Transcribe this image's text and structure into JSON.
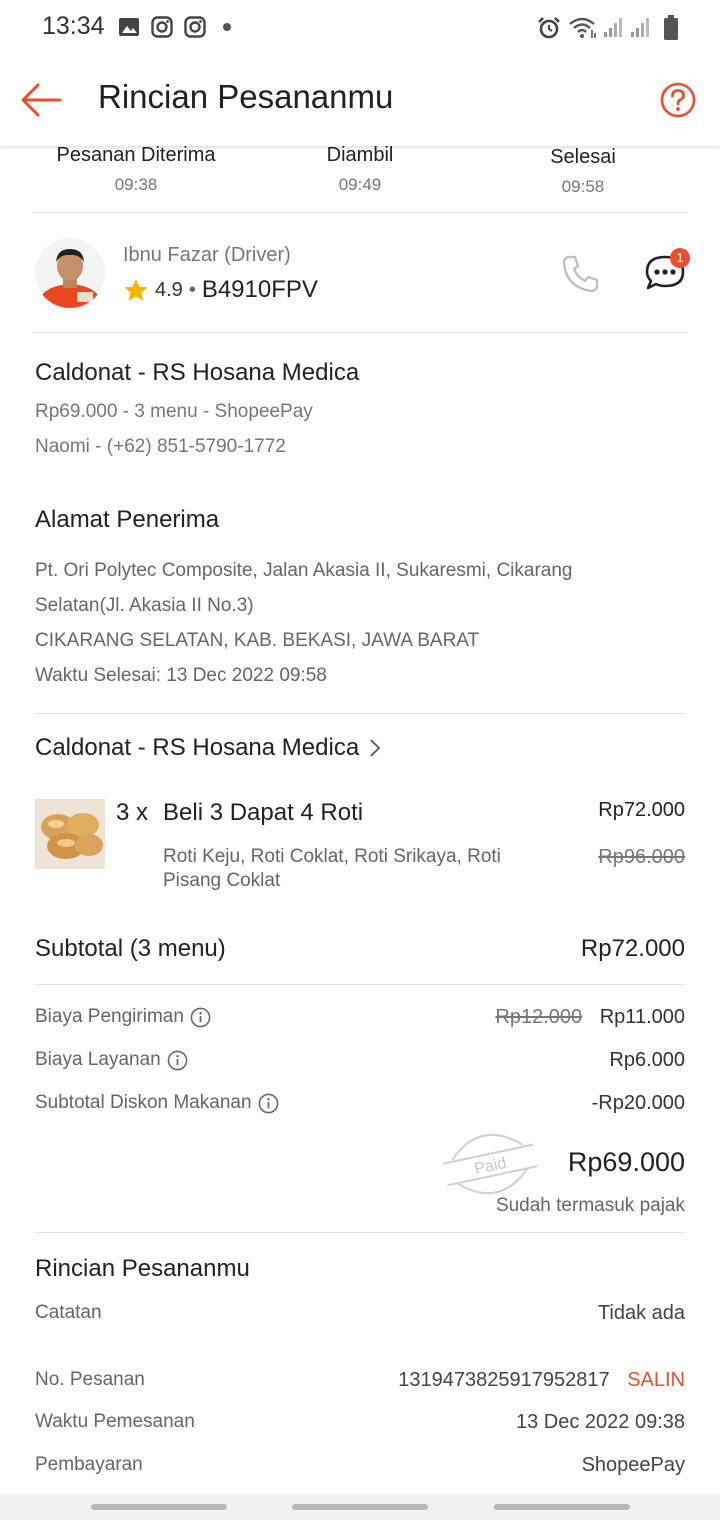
{
  "status_bar": {
    "time": "13:34"
  },
  "header": {
    "title": "Rincian Pesananmu"
  },
  "steps": [
    {
      "label": "Pesanan Diterima",
      "time": "09:38"
    },
    {
      "label": "Diambil",
      "time": "09:49"
    },
    {
      "label": "Selesai",
      "time": "09:58"
    }
  ],
  "driver": {
    "name": "Ibnu Fazar (Driver)",
    "rating": "4.9",
    "separator": "•",
    "plate": "B4910FPV",
    "chat_badge": "1"
  },
  "order_summary": {
    "store": "Caldonat - RS Hosana Medica",
    "line1": "Rp69.000 - 3 menu  - ShopeePay",
    "line2": "Naomi - (+62) 851-5790-1772"
  },
  "address": {
    "heading": "Alamat Penerima",
    "line1": "Pt. Ori Polytec Composite, Jalan Akasia II, Sukaresmi, Cikarang",
    "line2": "Selatan(Jl. Akasia II No.3)",
    "line3": "CIKARANG SELATAN, KAB. BEKASI, JAWA BARAT",
    "completed": "Waktu Selesai: 13 Dec 2022 09:58"
  },
  "store_section": {
    "name": "Caldonat - RS Hosana Medica"
  },
  "item": {
    "qty": "3 x",
    "name": "Beli 3 Dapat 4 Roti",
    "price": "Rp72.000",
    "options_line1": "Roti Keju, Roti Coklat, Roti Srikaya, Roti",
    "options_line2": "Pisang Coklat",
    "original_price": "Rp96.000"
  },
  "subtotal": {
    "label": "Subtotal (3 menu)",
    "value": "Rp72.000"
  },
  "fees": [
    {
      "label": "Biaya Pengiriman",
      "original": "Rp12.000",
      "value": "Rp11.000"
    },
    {
      "label": "Biaya Layanan",
      "value": "Rp6.000"
    },
    {
      "label": "Subtotal Diskon Makanan",
      "value": "-Rp20.000"
    }
  ],
  "total": {
    "stamp": "Paid",
    "value": "Rp69.000",
    "note": "Sudah termasuk pajak"
  },
  "details": {
    "heading": "Rincian Pesananmu",
    "note_label": "Catatan",
    "note_value": "Tidak ada",
    "order_no_label": "No. Pesanan",
    "order_no_value": "1319473825917952817",
    "copy_label": "SALIN",
    "order_time_label": "Waktu Pemesanan",
    "order_time_value": "13 Dec 2022 09:38",
    "payment_label": "Pembayaran",
    "payment_value": "ShopeePay"
  },
  "colors": {
    "accent": "#ee4d2d",
    "star": "#f5b50a"
  }
}
